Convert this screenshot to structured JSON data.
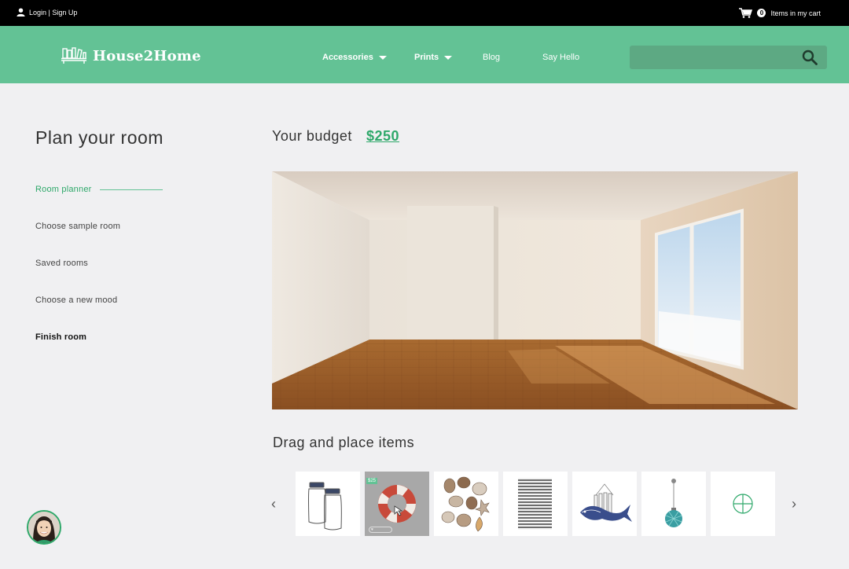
{
  "topbar": {
    "login_label": "Login | Sign Up",
    "cart_count": "0",
    "cart_label": "Items in my cart"
  },
  "header": {
    "brand": "House2Home",
    "nav": [
      "Accessories",
      "Prints",
      "Blog",
      "Say Hello"
    ],
    "search_placeholder": ""
  },
  "sidebar": {
    "title": "Plan your room",
    "items": [
      "Room planner",
      "Choose sample room",
      "Saved rooms",
      "Choose a new mood",
      "Finish room"
    ],
    "active_item": "Room planner"
  },
  "main": {
    "budget_label": "Your budget",
    "budget_amount": "$250",
    "drag_title": "Drag and place items",
    "prev_arrow": "‹",
    "next_arrow": "›"
  },
  "items": [
    {
      "name": "glass-jars"
    },
    {
      "name": "life-ring",
      "price": "$25",
      "selected": true
    },
    {
      "name": "seashells"
    },
    {
      "name": "striped-rug"
    },
    {
      "name": "welcome-fish-sign"
    },
    {
      "name": "glass-float-pendant"
    },
    {
      "name": "add-item"
    }
  ],
  "colors": {
    "brand_green": "#63c295",
    "accent_green": "#2ea86a",
    "topbar_black": "#000000",
    "page_bg": "#f0f0f2"
  }
}
